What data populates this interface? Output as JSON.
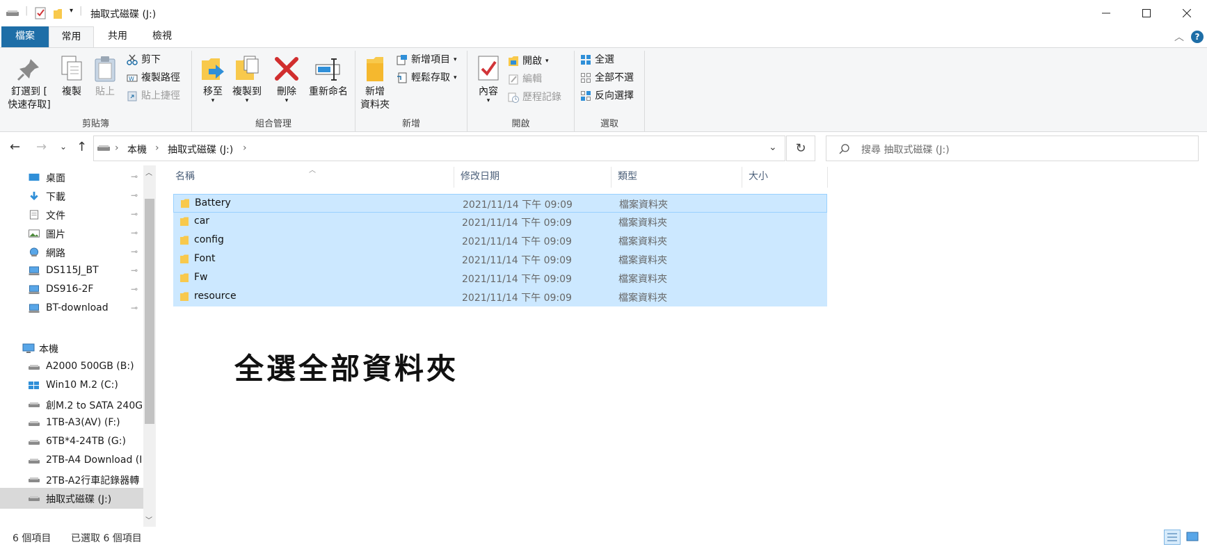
{
  "window": {
    "title": "抽取式磁碟 (J:)",
    "minimize_icon": "minimize-icon",
    "maximize_icon": "maximize-icon",
    "close_icon": "close-icon"
  },
  "tabs": [
    "檔案",
    "常用",
    "共用",
    "檢視"
  ],
  "ribbon": {
    "clipboard": {
      "label": "剪貼簿",
      "pin": "釘選到 [",
      "pin2": "快速存取]",
      "copy": "複製",
      "paste": "貼上",
      "cut": "剪下",
      "copy_path": "複製路徑",
      "paste_shortcut": "貼上捷徑"
    },
    "organize": {
      "label": "組合管理",
      "move_to": "移至",
      "copy_to": "複製到",
      "delete": "刪除",
      "rename": "重新命名"
    },
    "new": {
      "label": "新增",
      "new_folder": "新增",
      "new_folder2": "資料夾",
      "new_item": "新增項目",
      "easy_access": "輕鬆存取"
    },
    "open": {
      "label": "開啟",
      "properties": "內容",
      "open": "開啟",
      "edit": "編輯",
      "history": "歷程記錄"
    },
    "select": {
      "label": "選取",
      "select_all": "全選",
      "select_none": "全部不選",
      "invert": "反向選擇"
    }
  },
  "address": {
    "crumbs": [
      "本機",
      "抽取式磁碟 (J:)"
    ],
    "search_placeholder": "搜尋 抽取式磁碟 (J:)"
  },
  "sidebar": {
    "quick_access": [
      {
        "label": "桌面",
        "icon": "desktop-icon"
      },
      {
        "label": "下載",
        "icon": "download-icon"
      },
      {
        "label": "文件",
        "icon": "document-icon"
      },
      {
        "label": "圖片",
        "icon": "picture-icon"
      },
      {
        "label": "網路",
        "icon": "network-icon"
      },
      {
        "label": "DS115J_BT",
        "icon": "network-drive-icon"
      },
      {
        "label": "DS916-2F",
        "icon": "network-drive-icon"
      },
      {
        "label": "BT-download",
        "icon": "network-drive-icon"
      }
    ],
    "this_pc": "本機",
    "drives": [
      "A2000 500GB (B:)",
      "Win10 M.2 (C:)",
      "創M.2 to SATA 240G",
      "1TB-A3(AV) (F:)",
      "6TB*4-24TB (G:)",
      "2TB-A4 Download (I",
      "2TB-A2行車記錄器轉",
      "抽取式磁碟 (J:)"
    ]
  },
  "columns": {
    "name": "名稱",
    "date": "修改日期",
    "type": "類型",
    "size": "大小"
  },
  "files": [
    {
      "name": "Battery",
      "date": "2021/11/14 下午 09:09",
      "type": "檔案資料夾"
    },
    {
      "name": "car",
      "date": "2021/11/14 下午 09:09",
      "type": "檔案資料夾"
    },
    {
      "name": "config",
      "date": "2021/11/14 下午 09:09",
      "type": "檔案資料夾"
    },
    {
      "name": "Font",
      "date": "2021/11/14 下午 09:09",
      "type": "檔案資料夾"
    },
    {
      "name": "Fw",
      "date": "2021/11/14 下午 09:09",
      "type": "檔案資料夾"
    },
    {
      "name": "resource",
      "date": "2021/11/14 下午 09:09",
      "type": "檔案資料夾"
    }
  ],
  "caption": "全選全部資料夾",
  "status": {
    "count": "6 個項目",
    "selected": "已選取 6 個項目"
  },
  "colors": {
    "file_tab": "#1e6ea7",
    "selection": "#cce8ff",
    "selection_border": "#99d1ff",
    "folder": "#f8c94c"
  }
}
